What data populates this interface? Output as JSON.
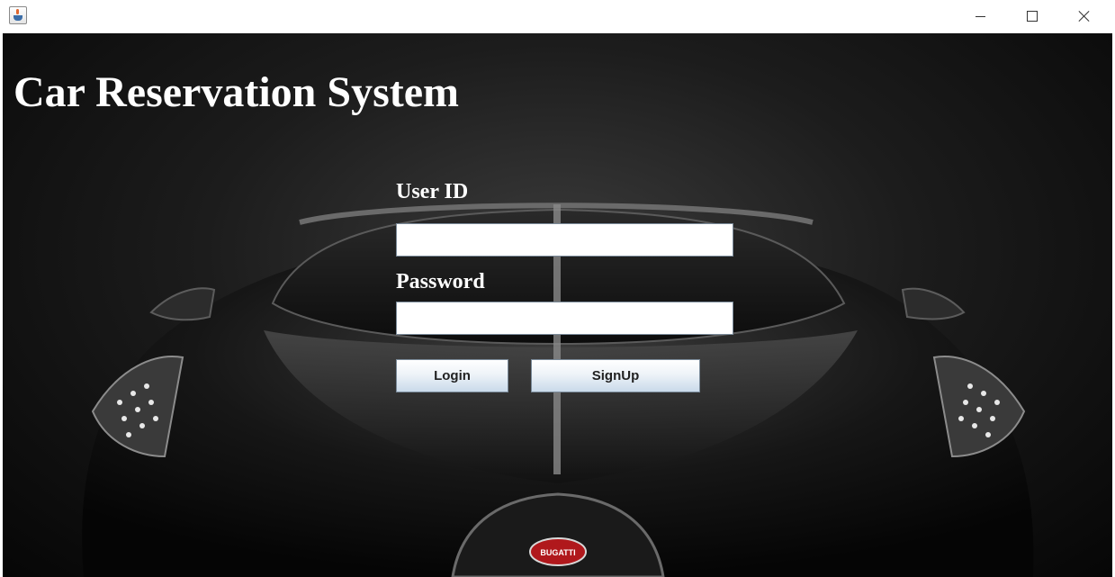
{
  "window": {
    "icon": "java-cup-icon",
    "controls": {
      "minimize": "minimize-icon",
      "maximize": "maximize-icon",
      "close": "close-icon"
    }
  },
  "app": {
    "title": "Car Reservation System"
  },
  "login_form": {
    "user_id_label": "User ID",
    "user_id_value": "",
    "password_label": "Password",
    "password_value": "",
    "login_button": "Login",
    "signup_button": "SignUp"
  },
  "background": {
    "badge_text": "BUGATTI",
    "badge_color": "#b0181c"
  }
}
